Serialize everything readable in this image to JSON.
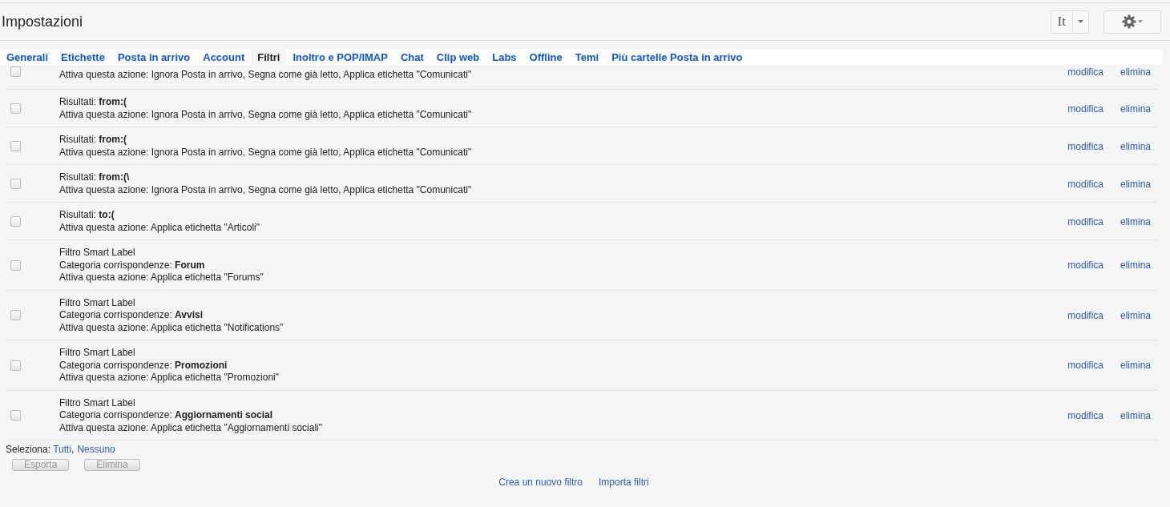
{
  "header": {
    "title": "Impostazioni",
    "language_button": "It"
  },
  "tabs": [
    {
      "label": "Generali",
      "selected": false
    },
    {
      "label": "Etichette",
      "selected": false
    },
    {
      "label": "Posta in arrivo",
      "selected": false
    },
    {
      "label": "Account",
      "selected": false
    },
    {
      "label": "Filtri",
      "selected": true
    },
    {
      "label": "Inoltro e POP/IMAP",
      "selected": false
    },
    {
      "label": "Chat",
      "selected": false
    },
    {
      "label": "Clip web",
      "selected": false
    },
    {
      "label": "Labs",
      "selected": false
    },
    {
      "label": "Offline",
      "selected": false
    },
    {
      "label": "Temi",
      "selected": false
    },
    {
      "label": "Più cartelle Posta in arrivo",
      "selected": false
    }
  ],
  "filters": [
    {
      "kind": "partial",
      "checked": false,
      "lines": [
        "Attiva questa azione: Ignora Posta in arrivo, Segna come già letto, Applica etichetta \"Comunicati\""
      ],
      "edit": "modifica",
      "delete": "elimina"
    },
    {
      "kind": "full",
      "checked": false,
      "lines": [
        "Risultati: **from:(**",
        "Attiva questa azione: Ignora Posta in arrivo, Segna come già letto, Applica etichetta \"Comunicati\""
      ],
      "edit": "modifica",
      "delete": "elimina"
    },
    {
      "kind": "full",
      "checked": false,
      "lines": [
        "Risultati: **from:(**",
        "Attiva questa azione: Ignora Posta in arrivo, Segna come già letto, Applica etichetta \"Comunicati\""
      ],
      "edit": "modifica",
      "delete": "elimina"
    },
    {
      "kind": "full",
      "checked": false,
      "lines": [
        "Risultati: **from:(\\**",
        "Attiva questa azione: Ignora Posta in arrivo, Segna come già letto, Applica etichetta \"Comunicati\""
      ],
      "edit": "modifica",
      "delete": "elimina"
    },
    {
      "kind": "full",
      "checked": false,
      "lines": [
        "Risultati: **to:(**",
        "Attiva questa azione: Applica etichetta \"Articoli\""
      ],
      "edit": "modifica",
      "delete": "elimina"
    },
    {
      "kind": "full",
      "checked": false,
      "lines": [
        "Filtro Smart Label",
        "Categoria corrispondenze: **Forum**",
        "Attiva questa azione: Applica etichetta \"Forums\""
      ],
      "edit": "modifica",
      "delete": "elimina"
    },
    {
      "kind": "full",
      "checked": false,
      "lines": [
        "Filtro Smart Label",
        "Categoria corrispondenze: **Avvisi**",
        "Attiva questa azione: Applica etichetta \"Notifications\""
      ],
      "edit": "modifica",
      "delete": "elimina"
    },
    {
      "kind": "full",
      "checked": false,
      "lines": [
        "Filtro Smart Label",
        "Categoria corrispondenze: **Promozioni**",
        "Attiva questa azione: Applica etichetta \"Promozioni\""
      ],
      "edit": "modifica",
      "delete": "elimina"
    },
    {
      "kind": "full",
      "checked": false,
      "lines": [
        "Filtro Smart Label",
        "Categoria corrispondenze: **Aggiornamenti social**",
        "Attiva questa azione: Applica etichetta \"Aggiornamenti sociali\""
      ],
      "edit": "modifica",
      "delete": "elimina"
    }
  ],
  "select": {
    "label": "Seleziona:",
    "all": "Tutti",
    "separator": ",",
    "none": "Nessuno"
  },
  "buttons": [
    {
      "label": "Esporta",
      "disabled": true
    },
    {
      "label": "Elimina",
      "disabled": true
    }
  ],
  "footer_links": [
    "Crea un nuovo filtro",
    "Importa filtri"
  ]
}
